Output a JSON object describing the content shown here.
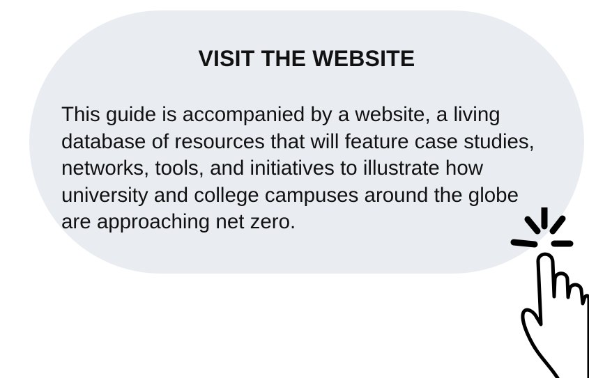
{
  "callout": {
    "heading": "VISIT THE WEBSITE",
    "body": "This guide is accompanied by a website, a living database of resources that will feature case studies, networks, tools, and initiatives to illustrate how university and college campuses around the globe are approaching net zero."
  },
  "colors": {
    "pill_background": "#e9edf2",
    "text": "#111111",
    "icon_stroke": "#000000",
    "icon_fill": "#ffffff"
  },
  "icons": {
    "pointer": "tap-hand-icon"
  }
}
